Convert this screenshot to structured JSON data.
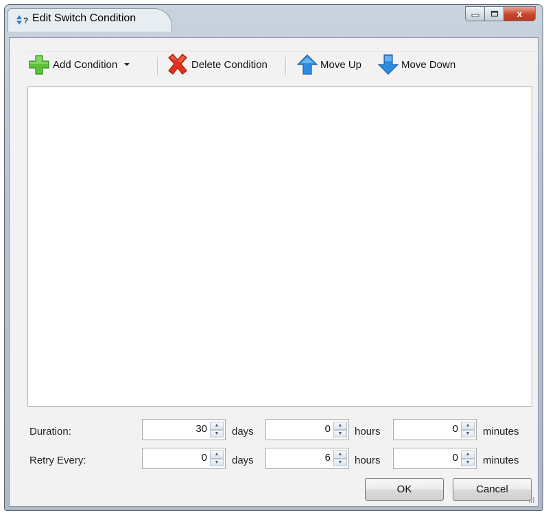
{
  "window": {
    "title": "Edit Switch Condition",
    "close_glyph": "x",
    "icons": {
      "app": "switch-condition-icon",
      "minimize": "minimize-icon",
      "maximize": "maximize-icon",
      "close": "close-icon"
    }
  },
  "toolbar": {
    "add_condition": "Add Condition",
    "delete_condition": "Delete Condition",
    "move_up": "Move Up",
    "move_down": "Move Down",
    "icons": {
      "add": "green-plus-icon",
      "dropdown": "dropdown-arrow-icon",
      "delete": "red-x-icon",
      "up": "blue-up-arrow-icon",
      "down": "blue-down-arrow-icon"
    }
  },
  "conditions": [],
  "duration": {
    "label": "Duration:",
    "days": "30",
    "days_unit": "days",
    "hours": "0",
    "hours_unit": "hours",
    "minutes": "0",
    "minutes_unit": "minutes"
  },
  "retry": {
    "label": "Retry Every:",
    "days": "0",
    "days_unit": "days",
    "hours": "6",
    "hours_unit": "hours",
    "minutes": "0",
    "minutes_unit": "minutes"
  },
  "buttons": {
    "ok": "OK",
    "cancel": "Cancel"
  },
  "colors": {
    "add": "#5cc13a",
    "delete": "#e0301e",
    "arrow": "#2e8ce0",
    "close": "#c8452c"
  }
}
